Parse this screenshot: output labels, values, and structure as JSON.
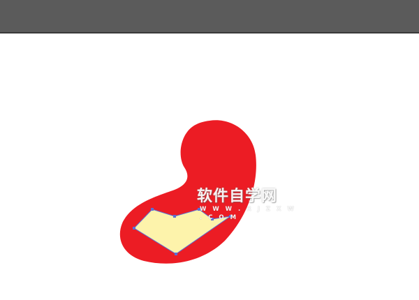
{
  "watermark": {
    "title": "软件自学网",
    "url": "W W W . R J Z X W . C O M"
  },
  "colors": {
    "topbar": "#5b5b5b",
    "shape_fill": "#ec1c24",
    "selection_fill": "#fdf3ab",
    "anchor_stroke": "#5a6fd6"
  },
  "icons": {
    "anchor_point": "small-square-anchor"
  }
}
